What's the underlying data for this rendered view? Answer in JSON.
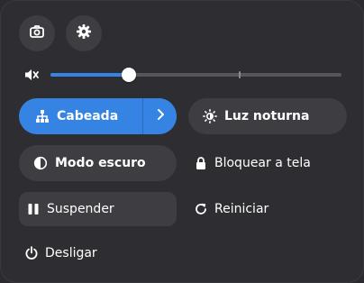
{
  "toolbar": {
    "screenshot_icon": "camera-icon",
    "settings_icon": "gear-icon"
  },
  "volume": {
    "icon": "speaker-muted-icon",
    "level": 0.27
  },
  "toggles": {
    "network": {
      "label": "Cabeada",
      "icon": "wired-network-icon",
      "active": true
    },
    "night_light": {
      "label": "Luz noturna",
      "icon": "sun-icon",
      "active": false
    },
    "dark_mode": {
      "label": "Modo escuro",
      "icon": "dark-mode-icon",
      "active": false
    }
  },
  "actions": {
    "lock": "Bloquear a tela",
    "suspend": "Suspender",
    "restart": "Reiniciar",
    "power_off": "Desligar"
  },
  "colors": {
    "accent": "#3584e4",
    "panel": "#2e2e32",
    "button": "#3d3d42"
  }
}
